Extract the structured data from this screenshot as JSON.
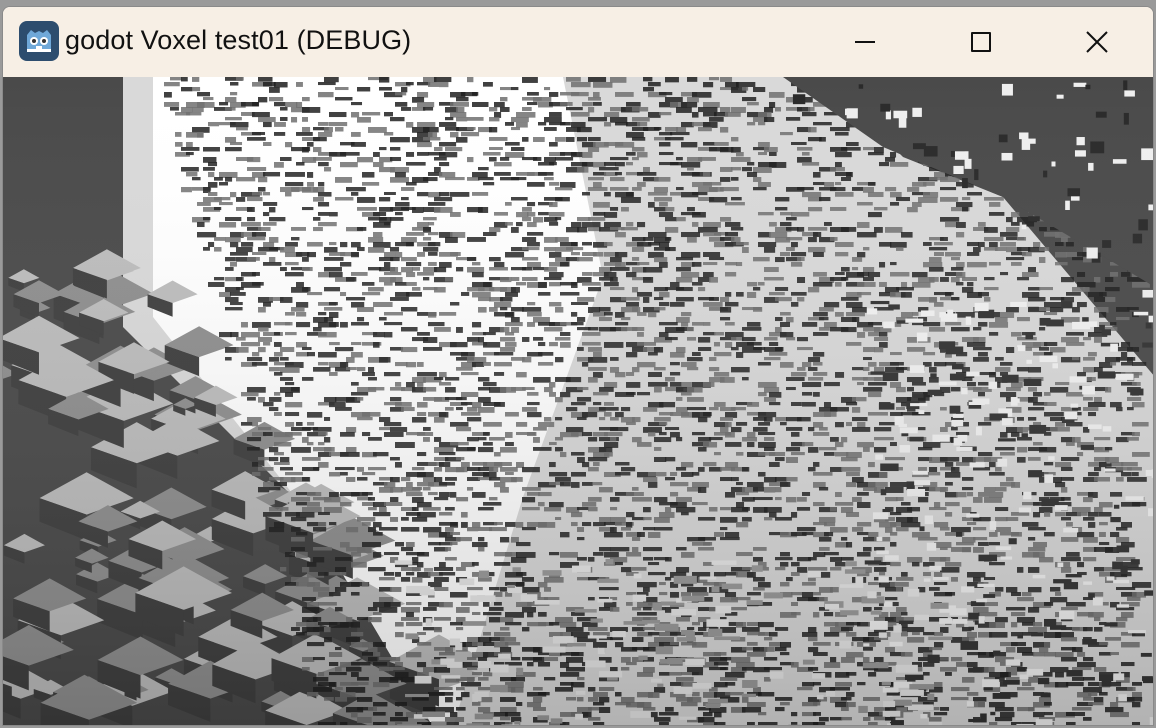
{
  "window": {
    "title": "godot Voxel test01 (DEBUG)",
    "app_icon": "godot-icon",
    "controls": {
      "minimize_icon": "minimize-icon",
      "maximize_icon": "maximize-icon",
      "close_icon": "close-icon"
    }
  },
  "viewport": {
    "description_icon": "voxel-terrain-3d-view",
    "colors": {
      "shadow": "#4a4a4a",
      "light": "#ffffff",
      "mid": "#a9a9a9"
    }
  }
}
